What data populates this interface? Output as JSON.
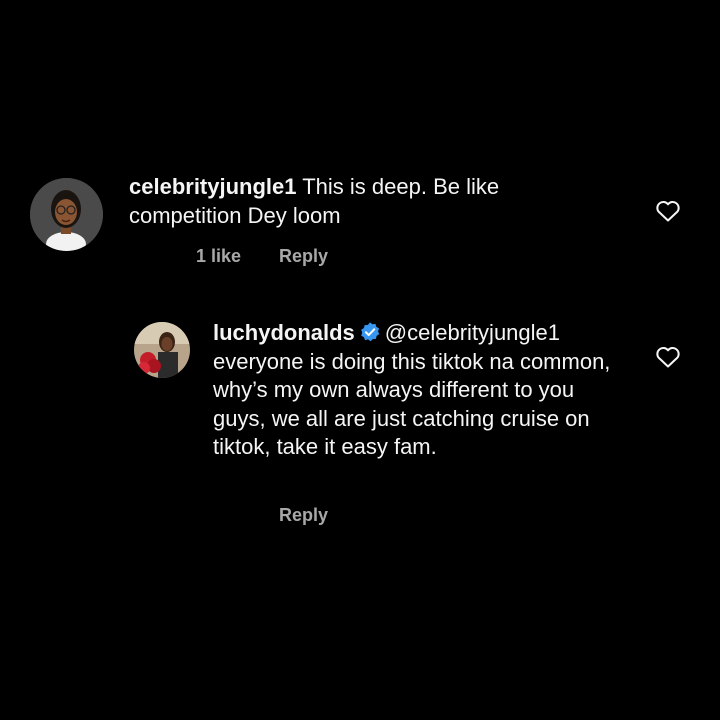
{
  "comments": [
    {
      "username": "celebrityjungle1",
      "text": "This is deep. Be like competition Dey loom",
      "likes": "1 like",
      "reply_label": "Reply"
    },
    {
      "username": "luchydonalds",
      "verified": true,
      "mention": "@celebrityjungle1",
      "text": "everyone is doing this tiktok na common, why’s my own always different to you guys, we all are just catching cruise on tiktok, take it easy fam.",
      "reply_label": "Reply"
    }
  ],
  "colors": {
    "background": "#000000",
    "text": "#f5f5f5",
    "meta": "#a8a8a8",
    "verified_badge": "#3797f0"
  }
}
